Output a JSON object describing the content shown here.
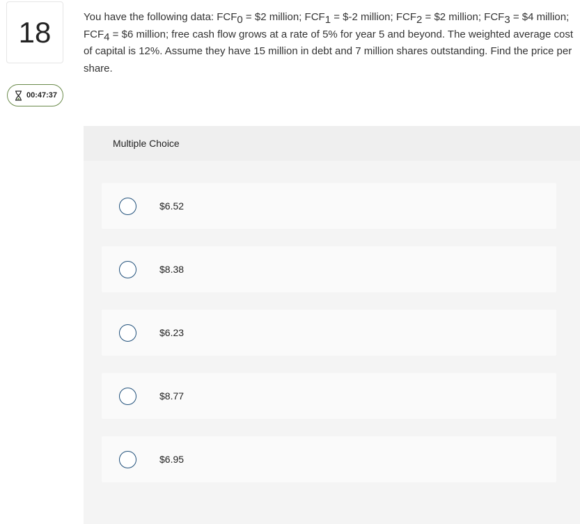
{
  "question": {
    "number": "18",
    "parts": {
      "p1": "You have the following data: FCF",
      "s0": "0",
      "p2": " = $2 million; FCF",
      "s1": "1",
      "p3": " = $-2 million; FCF",
      "s2": "2",
      "p4": " = $2 million; FCF",
      "s3": "3",
      "p5": " = $4 million; FCF",
      "s4": "4",
      "p6": " = $6 million; free cash flow grows at a rate of 5% for year 5 and beyond. The weighted average cost of capital is 12%.  Assume they have 15 million in debt and 7 million shares outstanding. Find the price per share."
    }
  },
  "timer": {
    "value": "00:47:37",
    "icon": "hourglass-icon"
  },
  "multiple_choice": {
    "header": "Multiple Choice",
    "options": [
      {
        "label": "$6.52"
      },
      {
        "label": "$8.38"
      },
      {
        "label": "$6.23"
      },
      {
        "label": "$8.77"
      },
      {
        "label": "$6.95"
      }
    ]
  },
  "colors": {
    "radio_border": "#1f4f7a",
    "timer_border": "#6a8a4a",
    "panel_bg": "#f4f4f4"
  }
}
